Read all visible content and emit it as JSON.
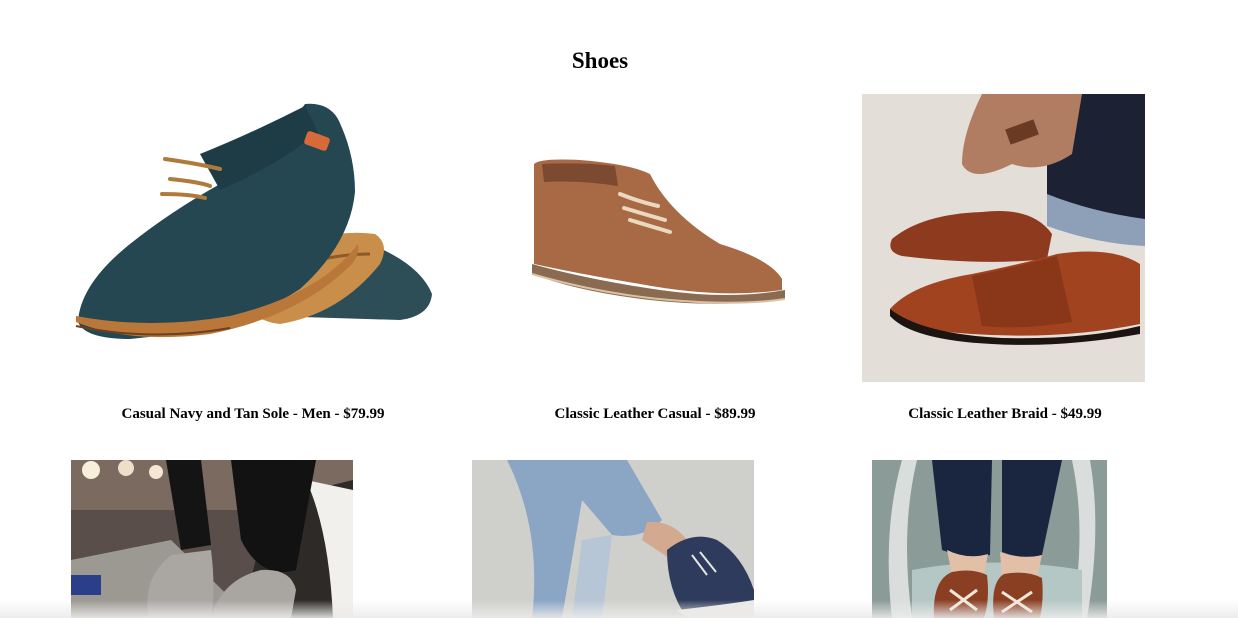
{
  "page": {
    "title": "Shoes"
  },
  "products": [
    {
      "caption": "Casual Navy and Tan Sole - Men - $79.99",
      "image": "navy-suede-shoe-image"
    },
    {
      "caption": "Classic Leather Casual - $89.99",
      "image": "tan-leather-chukka-image"
    },
    {
      "caption": "Classic Leather Braid - $49.99",
      "image": "braided-leather-shoes-photo"
    },
    {
      "caption": "",
      "image": "grey-suede-boots-photo"
    },
    {
      "caption": "",
      "image": "navy-sneakers-photo"
    },
    {
      "caption": "",
      "image": "brown-oxfords-on-chair-photo"
    }
  ]
}
